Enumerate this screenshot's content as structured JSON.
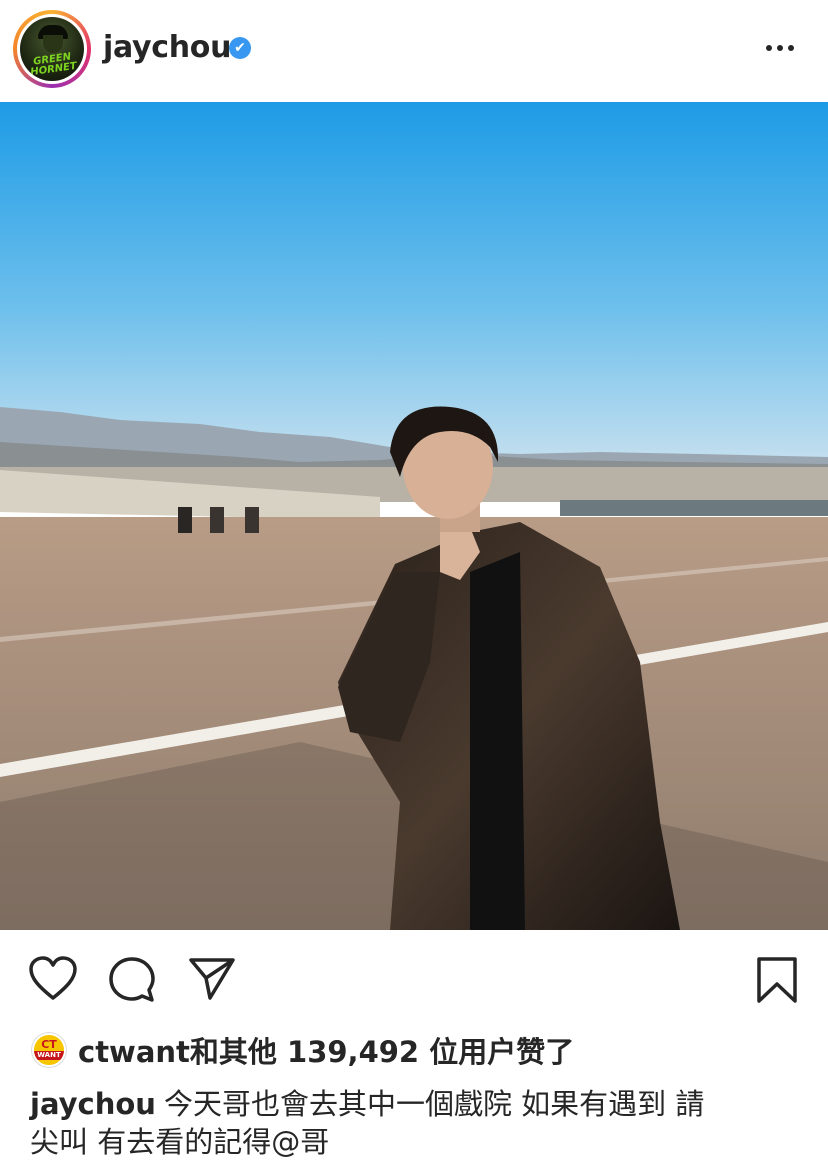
{
  "header": {
    "username": "jaychou",
    "verified_badge": "✔",
    "avatar_text": "GREEN HORNET",
    "more_icon": "more-horizontal-icon"
  },
  "post": {
    "photo_alt": "photo"
  },
  "actions": {
    "like_icon": "heart-icon",
    "comment_icon": "comment-icon",
    "share_icon": "share-icon",
    "save_icon": "bookmark-icon"
  },
  "likes": {
    "liker_logo_top": "CT",
    "liker_logo_bottom": "WANT",
    "liker": "ctwant",
    "text": "和其他 139,492 位用户赞了"
  },
  "caption": {
    "username": "jaychou",
    "line1": "今天哥也會去其中一個戲院  如果有遇到 請",
    "line2": "尖叫  有去看的記得@哥"
  },
  "colors": {
    "text": "#262626",
    "verified": "#3897f0",
    "sky_top": "#1e9ee8",
    "sky_bottom": "#b9d8ea",
    "ground": "#a08a78"
  }
}
